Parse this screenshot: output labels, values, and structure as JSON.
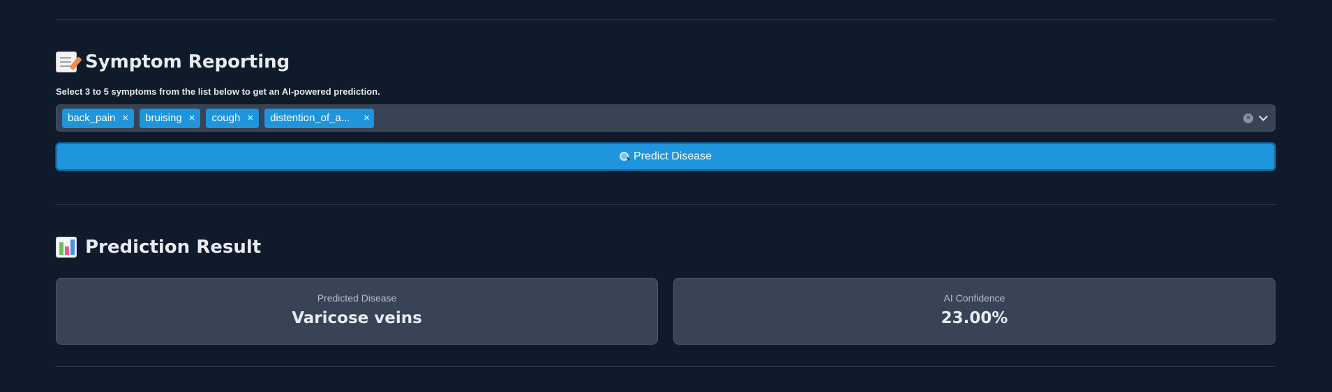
{
  "symptom_section": {
    "title": "Symptom Reporting",
    "icon": "memo-icon",
    "instruction": "Select 3 to 5 symptoms from the list below to get an AI-powered prediction.",
    "selected_symptoms": [
      "back_pain",
      "bruising",
      "cough",
      "distention_of_a..."
    ],
    "chip_remove_glyph": "×",
    "clear_glyph": "×"
  },
  "predict_button": {
    "label": "Predict Disease",
    "icon": "magnifier-icon",
    "color": "#1e95dc"
  },
  "result_section": {
    "title": "Prediction Result",
    "icon": "bar-chart-icon",
    "cards": [
      {
        "label": "Predicted Disease",
        "value": "Varicose veins"
      },
      {
        "label": "AI Confidence",
        "value": "23.00%"
      }
    ]
  },
  "theme": {
    "background": "#0f1a2a",
    "panel": "#394356",
    "accent": "#1e95dc"
  }
}
